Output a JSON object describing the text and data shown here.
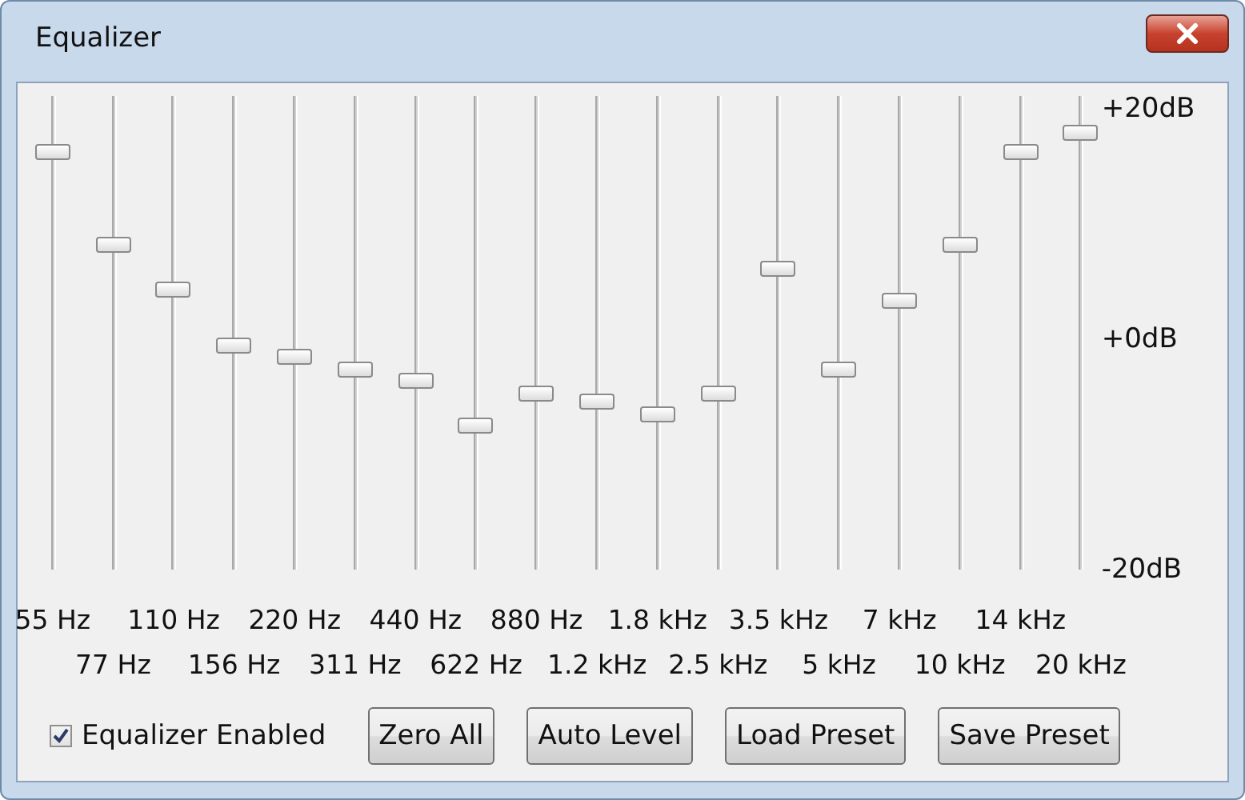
{
  "window": {
    "title": "Equalizer"
  },
  "bands": [
    {
      "label": "55 Hz",
      "level": 0.904
    },
    {
      "label": "77 Hz",
      "level": 0.696
    },
    {
      "label": "110 Hz",
      "level": 0.596
    },
    {
      "label": "156 Hz",
      "level": 0.471
    },
    {
      "label": "220 Hz",
      "level": 0.446
    },
    {
      "label": "311 Hz",
      "level": 0.418
    },
    {
      "label": "440 Hz",
      "level": 0.393
    },
    {
      "label": "622 Hz",
      "level": 0.293
    },
    {
      "label": "880 Hz",
      "level": 0.364
    },
    {
      "label": "1.2 kHz",
      "level": 0.346
    },
    {
      "label": "1.8 kHz",
      "level": 0.318
    },
    {
      "label": "2.5 kHz",
      "level": 0.364
    },
    {
      "label": "3.5 kHz",
      "level": 0.643
    },
    {
      "label": "5 kHz",
      "level": 0.418
    },
    {
      "label": "7 kHz",
      "level": 0.571
    },
    {
      "label": "10 kHz",
      "level": 0.696
    },
    {
      "label": "14 kHz",
      "level": 0.904
    },
    {
      "label": "20 kHz",
      "level": 0.946
    }
  ],
  "scale": [
    "+20dB",
    "+0dB",
    "-20dB"
  ],
  "enabled": {
    "label": "Equalizer Enabled",
    "checked": true
  },
  "buttons": [
    "Zero All",
    "Auto Level",
    "Load Preset",
    "Save Preset"
  ]
}
